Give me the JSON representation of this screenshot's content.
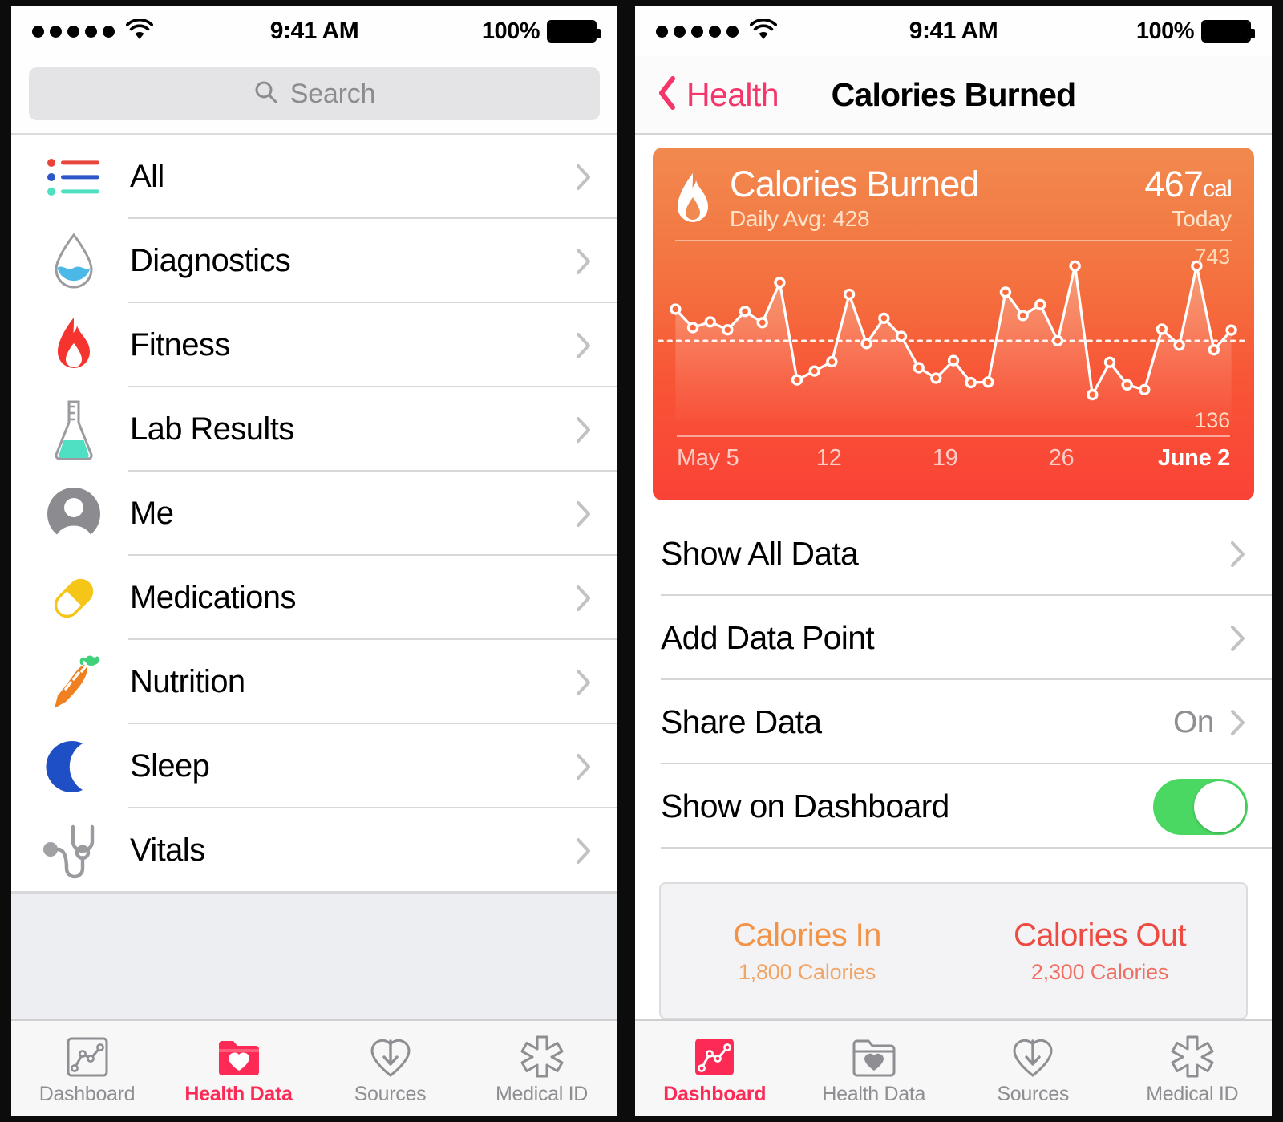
{
  "statusbar": {
    "signal_icon": "signal-dots-icon",
    "wifi_icon": "wifi-icon",
    "time": "9:41 AM",
    "battery_percent": "100%",
    "battery_icon": "battery-full-icon"
  },
  "left": {
    "search": {
      "placeholder": "Search",
      "icon": "search-icon"
    },
    "list": [
      {
        "label": "All",
        "icon": "list-lines-icon"
      },
      {
        "label": "Diagnostics",
        "icon": "water-droplet-icon"
      },
      {
        "label": "Fitness",
        "icon": "flame-icon"
      },
      {
        "label": "Lab Results",
        "icon": "flask-icon"
      },
      {
        "label": "Me",
        "icon": "person-avatar-icon"
      },
      {
        "label": "Medications",
        "icon": "pill-capsule-icon"
      },
      {
        "label": "Nutrition",
        "icon": "carrot-icon"
      },
      {
        "label": "Sleep",
        "icon": "crescent-moon-icon"
      },
      {
        "label": "Vitals",
        "icon": "stethoscope-icon"
      }
    ],
    "tabs": [
      {
        "label": "Dashboard",
        "icon": "dashboard-chart-icon",
        "active": false
      },
      {
        "label": "Health Data",
        "icon": "folder-heart-icon",
        "active": true
      },
      {
        "label": "Sources",
        "icon": "heart-download-icon",
        "active": false
      },
      {
        "label": "Medical ID",
        "icon": "star-of-life-icon",
        "active": false
      }
    ]
  },
  "right": {
    "nav": {
      "back_label": "Health",
      "back_icon": "chevron-left-icon",
      "title": "Calories Burned"
    },
    "card": {
      "icon": "flame-icon",
      "title": "Calories Burned",
      "subtitle": "Daily Avg: 428",
      "value": "467",
      "unit": "cal",
      "period": "Today"
    },
    "settings": [
      {
        "label": "Show All Data",
        "type": "disclosure",
        "value": ""
      },
      {
        "label": "Add Data Point",
        "type": "disclosure",
        "value": ""
      },
      {
        "label": "Share Data",
        "type": "disclosure",
        "value": "On"
      },
      {
        "label": "Show on Dashboard",
        "type": "toggle",
        "value": "On"
      }
    ],
    "calories_panel": {
      "in_title": "Calories In",
      "in_value": "1,800 Calories",
      "out_title": "Calories Out",
      "out_value": "2,300 Calories"
    },
    "tabs": [
      {
        "label": "Dashboard",
        "icon": "dashboard-chart-icon",
        "active": true
      },
      {
        "label": "Health Data",
        "icon": "folder-heart-icon",
        "active": false
      },
      {
        "label": "Sources",
        "icon": "heart-download-icon",
        "active": false
      },
      {
        "label": "Medical ID",
        "icon": "star-of-life-icon",
        "active": false
      }
    ]
  },
  "chart_data": {
    "type": "line",
    "title": "Calories Burned",
    "xlabel": "",
    "ylabel": "cal",
    "ylim": [
      136,
      743
    ],
    "ymax_label": "743",
    "ymin_label": "136",
    "average_line": 428,
    "average_label": "Daily Avg: 428",
    "xtick_labels": [
      "May 5",
      "12",
      "19",
      "26",
      "June 2"
    ],
    "xtick_positions": [
      0,
      7,
      14,
      21,
      28
    ],
    "x": [
      "May 5",
      "May 6",
      "May 7",
      "May 8",
      "May 9",
      "May 10",
      "May 11",
      "May 12",
      "May 13",
      "May 14",
      "May 15",
      "May 16",
      "May 17",
      "May 18",
      "May 19",
      "May 20",
      "May 21",
      "May 22",
      "May 23",
      "May 24",
      "May 25",
      "May 26",
      "May 27",
      "May 28",
      "May 29",
      "May 30",
      "May 31",
      "June 1",
      "June 2"
    ],
    "values": [
      543,
      476,
      497,
      468,
      535,
      494,
      640,
      286,
      318,
      352,
      597,
      418,
      510,
      444,
      330,
      292,
      356,
      276,
      278,
      605,
      520,
      560,
      428,
      700,
      232,
      350,
      268,
      250,
      470,
      412,
      700,
      395,
      467
    ],
    "series": [
      {
        "name": "Calories Burned",
        "values": [
          543,
          476,
          497,
          468,
          535,
          494,
          640,
          286,
          318,
          352,
          597,
          418,
          510,
          444,
          330,
          292,
          356,
          276,
          278,
          605,
          520,
          560,
          428,
          700,
          232,
          350,
          268,
          250,
          470,
          412,
          700,
          395,
          467
        ]
      }
    ],
    "grid": false,
    "legend": "none",
    "marker": "circle",
    "line_color": "#ffffff",
    "fill": "gradient-orange-red"
  },
  "colors": {
    "accent_pink": "#fc2a55",
    "back_link": "#f4366a",
    "toggle_on": "#4ad863",
    "card_gradient_top": "#f18a4f",
    "card_gradient_bottom": "#fa4236",
    "calories_in": "#f39347",
    "calories_out": "#ef4a42"
  }
}
